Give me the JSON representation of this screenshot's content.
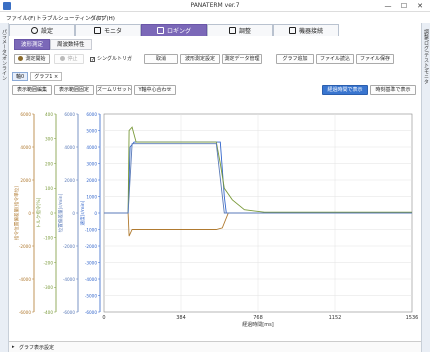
{
  "window": {
    "title": "PANATERM ver.7",
    "minimize": "—",
    "maximize": "☐",
    "close": "✕"
  },
  "menu": [
    "ファイル(F)",
    "トラブルシューティング(T)",
    "ヘルプ(H)"
  ],
  "side": {
    "left_label": "パラメータ/オンライン",
    "right_label": "調整/ログ/テスト/モニタ"
  },
  "tabs": [
    {
      "label": "設定",
      "icon": "gear-icon"
    },
    {
      "label": "モニタ",
      "icon": "monitor-icon"
    },
    {
      "label": "ロギング",
      "icon": "logging-icon"
    },
    {
      "label": "調整",
      "icon": "tuning-icon"
    },
    {
      "label": "機器接続",
      "icon": "connection-icon"
    }
  ],
  "active_tab": 2,
  "subtabs": [
    "波形測定",
    "周波数特性"
  ],
  "active_subtab": 0,
  "toolbar": {
    "start": "測定開始",
    "stop": "停止",
    "single_trigger": "シングルトリガ",
    "single_trigger_checked": true,
    "cancel": "取消",
    "wave_settings": "波形測定設定",
    "data_management": "測定データ管理",
    "graph_append": "グラフ追加",
    "file_load": "ファイル読込",
    "file_save": "ファイル保存"
  },
  "graph_tabs": [
    "軸0",
    "グラフ1"
  ],
  "graph_tab_close": "×",
  "graph_toolbar": {
    "edit_range": "表示範囲編集",
    "fix_range": "表示範囲固定",
    "zoom_reset": "ズームリセット",
    "y_center": "Y軸中心合わせ",
    "elapsed_display": "経過時間で表示",
    "time_ref_display": "時刻基準で表示"
  },
  "bottom_bar": "グラフ表示設定",
  "colors": {
    "accent": "#7b68b8",
    "primary_button": "#3975cf",
    "series_velocity_cmd": "#3366cc",
    "series_velocity": "#7a9a3a",
    "series_torque": "#b07a30",
    "series_position": "#5a7ab8"
  },
  "chart_data": {
    "type": "line",
    "xlabel": "経過時間[ms]",
    "x_ticks": [
      "0",
      "384",
      "768",
      "1152",
      "1536"
    ],
    "xlim": [
      0,
      1536
    ],
    "grid": true,
    "y_axes": [
      {
        "label": "指令位置偏差量[指令単位]",
        "color": "#b07a30",
        "ticks": [
          "6000",
          "4000",
          "2000",
          "0",
          "-2000",
          "-4000",
          "-6000"
        ],
        "ylim": [
          -6000,
          6000
        ]
      },
      {
        "label": "トルク指令[%]",
        "color": "#7a9a3a",
        "ticks": [
          "400",
          "300",
          "200",
          "100",
          "0",
          "-100",
          "-200",
          "-300",
          "-400"
        ],
        "ylim": [
          -400,
          400
        ]
      },
      {
        "label": "位置偏差量[r/min]",
        "color": "#5a7ab8",
        "ticks": [
          "6000",
          "4000",
          "2000",
          "0",
          "-2000",
          "-4000",
          "-6000"
        ],
        "ylim": [
          -6000,
          6000
        ]
      },
      {
        "label": "速度[r/min]",
        "color": "#3366cc",
        "ticks": [
          "6000",
          "5000",
          "4000",
          "3000",
          "2000",
          "1000",
          "0",
          "-1000",
          "-2000",
          "-3000",
          "-4000",
          "-5000",
          "-6000"
        ],
        "ylim": [
          -6000,
          6000
        ]
      }
    ],
    "series": [
      {
        "color": "#3366cc",
        "points": [
          [
            0,
            0
          ],
          [
            120,
            0
          ],
          [
            130,
            4000
          ],
          [
            150,
            4300
          ],
          [
            560,
            4300
          ],
          [
            580,
            4300
          ],
          [
            600,
            1000
          ],
          [
            610,
            0
          ],
          [
            1536,
            0
          ]
        ]
      },
      {
        "color": "#7a9a3a",
        "points": [
          [
            0,
            0
          ],
          [
            120,
            0
          ],
          [
            125,
            5000
          ],
          [
            140,
            5200
          ],
          [
            160,
            4300
          ],
          [
            560,
            4300
          ],
          [
            580,
            3000
          ],
          [
            600,
            1500
          ],
          [
            640,
            800
          ],
          [
            700,
            200
          ],
          [
            800,
            50
          ],
          [
            1536,
            50
          ]
        ]
      },
      {
        "color": "#b07a30",
        "points": [
          [
            0,
            0
          ],
          [
            120,
            0
          ],
          [
            125,
            -1400
          ],
          [
            140,
            -1000
          ],
          [
            560,
            -1000
          ],
          [
            590,
            -900
          ],
          [
            620,
            0
          ],
          [
            1536,
            0
          ]
        ]
      },
      {
        "color": "#5a7ab8",
        "points": [
          [
            0,
            0
          ],
          [
            120,
            0
          ],
          [
            140,
            4200
          ],
          [
            560,
            4200
          ],
          [
            600,
            0
          ],
          [
            1536,
            0
          ]
        ]
      }
    ]
  }
}
